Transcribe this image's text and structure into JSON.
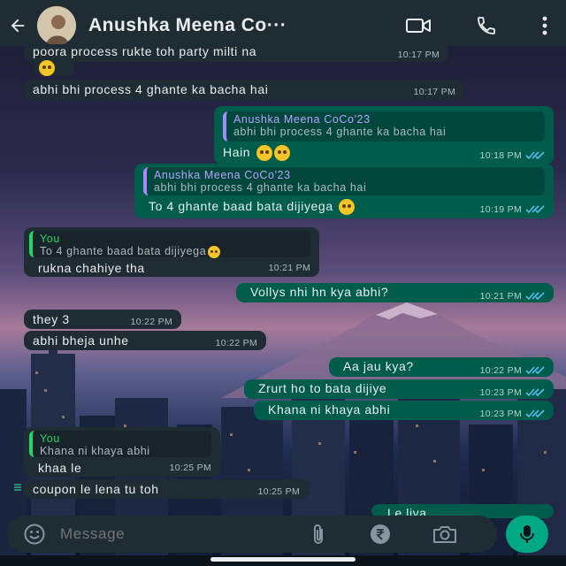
{
  "header": {
    "title": "Anushka Meena Co···",
    "back_icon": "arrow-left-icon",
    "video_icon": "video-call-icon",
    "call_icon": "phone-icon",
    "menu_icon": "more-vertical-icon"
  },
  "messages": [
    {
      "dir": "in",
      "text": "poora process rukte toh party milti na",
      "time": "10:17 PM"
    },
    {
      "dir": "in",
      "text": "abhi bhi process 4 ghante ka bacha hai",
      "time": "10:17 PM"
    },
    {
      "dir": "out",
      "reply_name": "Anushka Meena CoCo'23",
      "reply_text": "abhi bhi process 4 ghante ka bacha hai",
      "text": "Hain",
      "time": "10:18 PM"
    },
    {
      "dir": "out",
      "reply_name": "Anushka Meena CoCo'23",
      "reply_text": "abhi bhi process 4 ghante ka bacha hai",
      "text": "To 4 ghante baad bata dijiyega",
      "time": "10:19 PM"
    },
    {
      "dir": "in",
      "reply_name": "You",
      "reply_text": "To 4 ghante baad bata dijiyega",
      "text": "rukna chahiye tha",
      "time": "10:21 PM"
    },
    {
      "dir": "out",
      "text": "Vollys nhi hn kya abhi?",
      "time": "10:21 PM"
    },
    {
      "dir": "in",
      "text": "they 3",
      "time": "10:22 PM"
    },
    {
      "dir": "in",
      "text": "abhi bheja unhe",
      "time": "10:22 PM"
    },
    {
      "dir": "out",
      "text": "Aa jau kya?",
      "time": "10:22 PM"
    },
    {
      "dir": "out",
      "text": "Zrurt ho to bata dijiye",
      "time": "10:23 PM"
    },
    {
      "dir": "out",
      "text": "Khana ni khaya abhi",
      "time": "10:23 PM"
    },
    {
      "dir": "in",
      "reply_name": "You",
      "reply_text": "Khana ni khaya abhi",
      "text": "khaa le",
      "time": "10:25 PM"
    },
    {
      "dir": "in",
      "text": "coupon le lena tu toh",
      "time": "10:25 PM"
    },
    {
      "dir": "out",
      "text": "Le liya",
      "time": ""
    }
  ],
  "input": {
    "placeholder": "Message",
    "emoji_icon": "emoji-icon",
    "attach_icon": "paperclip-icon",
    "payment_icon": "rupee-payment-icon",
    "camera_icon": "camera-icon",
    "mic_icon": "microphone-icon"
  },
  "colors": {
    "header_bg": "#1f2c34",
    "incoming_bubble": "#1f2c34",
    "outgoing_bubble": "#005c4b",
    "accent": "#00a884",
    "read_ticks": "#53bdeb"
  }
}
